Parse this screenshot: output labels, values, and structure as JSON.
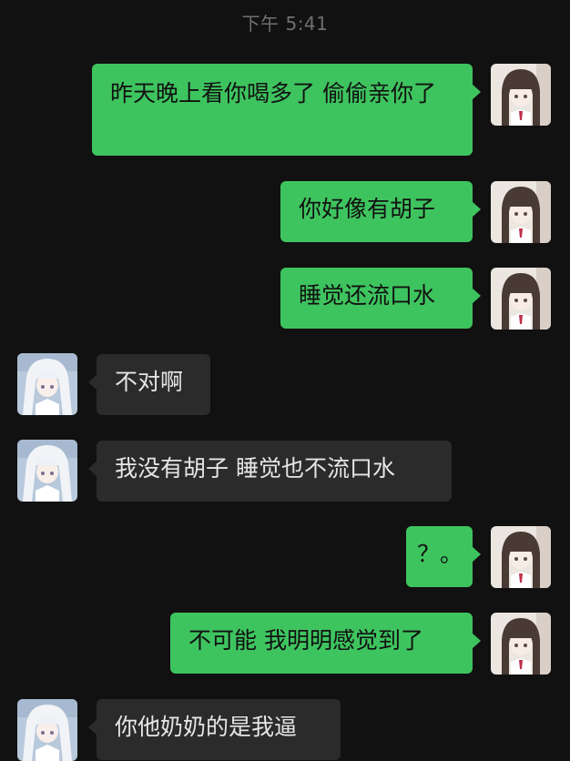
{
  "timestamp": "下午 5:41",
  "messages": [
    {
      "side": "out",
      "text": "昨天晚上看你喝多了 偷偷亲你了"
    },
    {
      "side": "out",
      "text": "你好像有胡子"
    },
    {
      "side": "out",
      "text": "睡觉还流口水"
    },
    {
      "side": "in",
      "text": "不对啊"
    },
    {
      "side": "in",
      "text": "我没有胡子 睡觉也不流口水"
    },
    {
      "side": "out",
      "text": "？。"
    },
    {
      "side": "out",
      "text": "不可能 我明明感觉到了"
    },
    {
      "side": "in",
      "text": "你他奶奶的是我逼"
    }
  ],
  "avatars": {
    "self": "anime-girl-dark-hair-avatar",
    "contact": "anime-girl-white-hair-avatar"
  },
  "colors": {
    "background": "#111111",
    "outgoing_bubble": "#3ec45f",
    "incoming_bubble": "#2b2b2b",
    "timestamp": "#6f6f6f"
  }
}
